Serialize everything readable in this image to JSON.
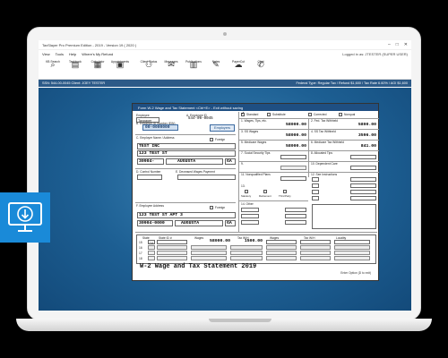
{
  "window": {
    "title": "TaxSlayer Pro Premium Edition - 2019 - Version 19 ( 2020 )",
    "controls": [
      "–",
      "□",
      "✕"
    ]
  },
  "menu": {
    "items": [
      "View",
      "Tools",
      "Help",
      "Where's My Refund"
    ],
    "logged_in": "Logged in as: JTESTER (SUPER USER)"
  },
  "toolbar": [
    {
      "label": "KB Search",
      "icon": "search-icon",
      "glyph": "⌕"
    },
    {
      "label": "Taskbook",
      "icon": "book-icon",
      "glyph": "▤"
    },
    {
      "label": "Calculator",
      "icon": "calculator-icon",
      "glyph": "▦"
    },
    {
      "label": "Appointments",
      "icon": "calendar-icon",
      "glyph": "▣"
    },
    {
      "label": "Client Status",
      "icon": "client-status-icon",
      "glyph": "⚇"
    },
    {
      "label": "Messages",
      "icon": "envelope-icon",
      "glyph": "✉"
    },
    {
      "label": "Publications",
      "icon": "publications-icon",
      "glyph": "▥"
    },
    {
      "label": "Notes",
      "icon": "notes-icon",
      "glyph": "✎"
    },
    {
      "label": "PaperCut",
      "icon": "cloud-upload-icon",
      "glyph": "☁"
    },
    {
      "label": "Chat",
      "icon": "chat-icon",
      "glyph": "✆"
    }
  ],
  "infobar": {
    "ssn": "SSN: 544-00-0045    Client: JOEY TESTER",
    "status": "Federal Type: Regular Tax / Refund $1,600 / Tax Rate 6.60% / AGI $1,600"
  },
  "form": {
    "header": "Form W-2 Wage and Tax Statement <Ctrl+E> - Exit without saving",
    "employee_label": "Employee",
    "employee_value": "Taxpayer",
    "employee_id_label": "A. Employee ID",
    "employee_id_value": "544-00-0045",
    "ein_label": "B. Employer ID Number (EIN)",
    "ein_value": "00-0000000",
    "employers_button": "Employers",
    "employer_name_label": "C. Employer Name / Address",
    "foreign_label": "Foreign",
    "employer_name": "TEST INC",
    "employer_street": "123 TEST ST",
    "employer_zip": "30904-",
    "employer_city": "AUGUSTA",
    "employer_state": "GA",
    "control_label": "D. Control Number",
    "deceased_label": "E. Deceased Wages Payment",
    "employee_address_label": "F. Employee Address",
    "employee_foreign_label": "Foreign",
    "employee_street": "123 TEST ST APT 3",
    "employee_zip": "30904-0000",
    "employee_city": "AUGUSTA",
    "employee_state": "GA",
    "checks": [
      "Standard",
      "Substitute",
      "Corrected",
      "Nonqual"
    ],
    "box1_label": "1. Wages, Tips, etc.",
    "box1_value": "58000.00",
    "box2_label": "2. Fed. Tax Withheld",
    "box2_value": "5800.00",
    "box3_label": "3. SS Wages",
    "box3_value": "58000.00",
    "box4_label": "4. SS Tax Withheld",
    "box4_value": "3596.00",
    "box5_label": "5. Medicare Wages",
    "box5_value": "58000.00",
    "box6_label": "6. Medicare Tax Withheld",
    "box6_value": "841.00",
    "box7_label": "7. Social Security Tips",
    "box8_label": "8. Allocated Tips",
    "box9_label": "9.",
    "box10_label": "10. Dependent Care",
    "box11_label": "11. Nonqualified Plans",
    "box12_label": "12. See Instructions",
    "box13_label": "13.",
    "statutory_label": "Statutory",
    "retirement_label": "Retirement",
    "sickpay_label": "Third Party",
    "box14_label": "14. Other",
    "state_headers": [
      "State",
      "State ID #",
      "Wages",
      "Tax W/H",
      "Wages",
      "Tax W/H",
      "Locality"
    ],
    "state_row1_wages": "58000.00",
    "state_row1_tax": "1500.00",
    "state_rows": [
      "15",
      "16",
      "17",
      "18",
      "19"
    ],
    "state_code": "GA",
    "footer_title": "W-2 Wage and Tax Statement  2019",
    "footer_note": "Enter Option (D to exit)"
  },
  "badge": {
    "icon": "download-monitor-icon"
  }
}
